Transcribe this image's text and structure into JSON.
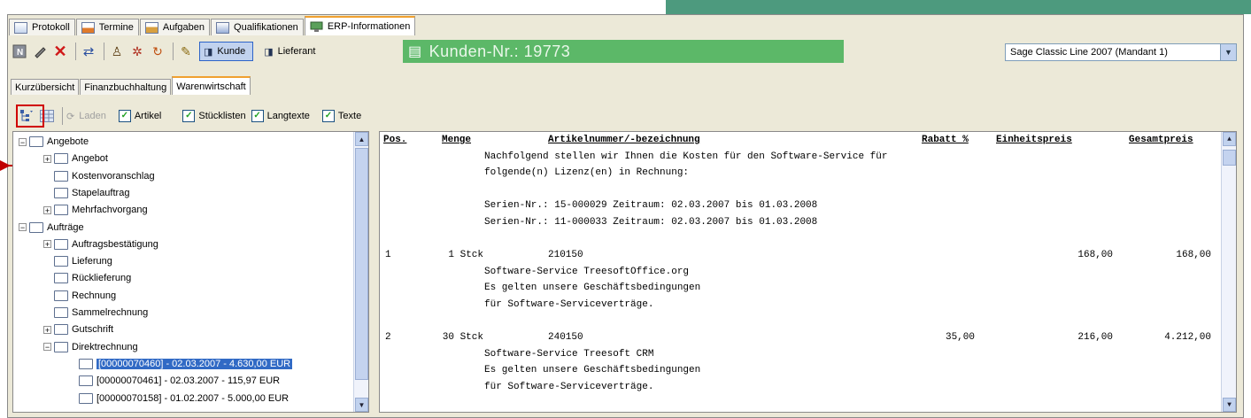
{
  "tabs": [
    {
      "label": "Protokoll",
      "icon": "protocol-icon"
    },
    {
      "label": "Termine",
      "icon": "calendar-icon"
    },
    {
      "label": "Aufgaben",
      "icon": "tasks-icon"
    },
    {
      "label": "Qualifikationen",
      "icon": "qualifications-icon"
    },
    {
      "label": "ERP-Informationen",
      "icon": "erp-icon",
      "active": true
    }
  ],
  "toolbar": {
    "kunde_label": "Kunde",
    "lieferant_label": "Lieferant",
    "kunden_nr": "Kunden-Nr.: 19773",
    "mandant_value": "Sage Classic Line 2007 (Mandant 1)"
  },
  "subtabs": [
    {
      "label": "Kurzübersicht"
    },
    {
      "label": "Finanzbuchhaltung"
    },
    {
      "label": "Warenwirtschaft",
      "active": true
    }
  ],
  "options": {
    "laden_label": "Laden",
    "checkboxes": [
      {
        "label": "Artikel",
        "checked": true
      },
      {
        "label": "Stücklisten",
        "checked": true
      },
      {
        "label": "Langtexte",
        "checked": true
      },
      {
        "label": "Texte",
        "checked": true
      }
    ]
  },
  "tree": [
    {
      "label": "Angebote",
      "level": 0,
      "expander": "−"
    },
    {
      "label": "Angebot",
      "level": 1,
      "expander": "+"
    },
    {
      "label": "Kostenvoranschlag",
      "level": 1,
      "expander": ""
    },
    {
      "label": "Stapelauftrag",
      "level": 1,
      "expander": ""
    },
    {
      "label": "Mehrfachvorgang",
      "level": 1,
      "expander": "+"
    },
    {
      "label": "Aufträge",
      "level": 0,
      "expander": "−"
    },
    {
      "label": "Auftragsbestätigung",
      "level": 1,
      "expander": "+"
    },
    {
      "label": "Lieferung",
      "level": 1,
      "expander": ""
    },
    {
      "label": "Rücklieferung",
      "level": 1,
      "expander": ""
    },
    {
      "label": "Rechnung",
      "level": 1,
      "expander": ""
    },
    {
      "label": "Sammelrechnung",
      "level": 1,
      "expander": ""
    },
    {
      "label": "Gutschrift",
      "level": 1,
      "expander": "+"
    },
    {
      "label": "Direktrechnung",
      "level": 1,
      "expander": "−"
    },
    {
      "label": "[00000070460] - 02.03.2007 - 4.630,00 EUR",
      "level": 2,
      "expander": "",
      "selected": true
    },
    {
      "label": "[00000070461] - 02.03.2007 - 115,97 EUR",
      "level": 2,
      "expander": ""
    },
    {
      "label": "[00000070158] - 01.02.2007 - 5.000,00 EUR",
      "level": 2,
      "expander": ""
    }
  ],
  "document": {
    "headers": {
      "pos": "Pos.",
      "menge": "Menge",
      "artikel": "Artikelnummer/-bezeichnung",
      "rabatt": "Rabatt %",
      "einzelpreis": "Einheitspreis",
      "gesamtpreis": "Gesamtpreis"
    },
    "intro": [
      "Nachfolgend stellen wir Ihnen die Kosten für den Software-Service für",
      "folgende(n) Lizenz(en) in Rechnung:",
      "",
      "Serien-Nr.: 15-000029 Zeitraum: 02.03.2007 bis 01.03.2008",
      "Serien-Nr.: 11-000033 Zeitraum: 02.03.2007 bis 01.03.2008"
    ],
    "items": [
      {
        "pos": "1",
        "menge": "1 Stck",
        "artnr": "210150",
        "rabatt": "",
        "einzel": "168,00",
        "gesamt": "168,00",
        "text": [
          "Software-Service TreesoftOffice.org",
          "Es gelten unsere Geschäftsbedingungen",
          "für Software-Serviceverträge."
        ]
      },
      {
        "pos": "2",
        "menge": "30 Stck",
        "artnr": "240150",
        "rabatt": "35,00",
        "einzel": "216,00",
        "gesamt": "4.212,00",
        "text": [
          "Software-Service Treesoft CRM",
          "Es gelten unsere Geschäftsbedingungen",
          "für Software-Serviceverträge."
        ]
      }
    ]
  }
}
